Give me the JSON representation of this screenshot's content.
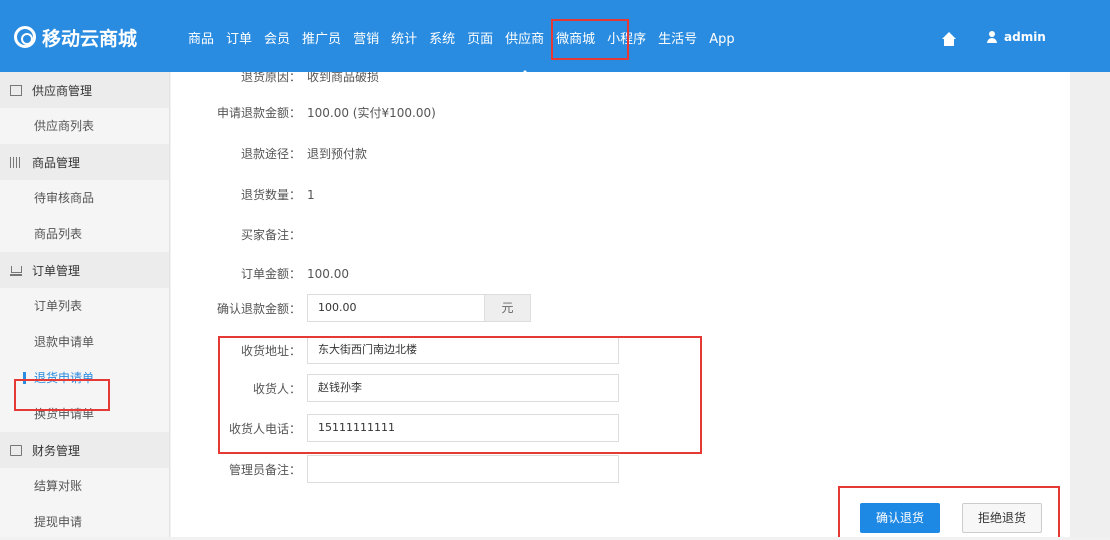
{
  "header": {
    "brand": "移动云商城",
    "nav": [
      "商品",
      "订单",
      "会员",
      "推广员",
      "营销",
      "统计",
      "系统",
      "页面",
      "供应商",
      "微商城",
      "小程序",
      "生活号",
      "App"
    ],
    "active_nav": "供应商",
    "user": "admin",
    "colors": {
      "bar": "#2a8ce0",
      "highlight": "#e53935"
    }
  },
  "sidebar": {
    "groups": [
      {
        "title": "供应商管理",
        "icon": "store-icon",
        "items": [
          "供应商列表"
        ]
      },
      {
        "title": "商品管理",
        "icon": "barcode-icon",
        "items": [
          "待审核商品",
          "商品列表"
        ]
      },
      {
        "title": "订单管理",
        "icon": "cart-icon",
        "items": [
          "订单列表",
          "退款申请单",
          "退货申请单",
          "换货申请单"
        ]
      },
      {
        "title": "财务管理",
        "icon": "money-icon",
        "items": [
          "结算对账",
          "提现申请"
        ]
      }
    ],
    "active_item": "退货申请单"
  },
  "form": {
    "cut_top_label": "退货原因：",
    "cut_top_value": "收到商品破损",
    "refund_amount_label": "申请退款金额：",
    "refund_amount_value": "100.00 (实付¥100.00)",
    "refund_route_label": "退款途径：",
    "refund_route_value": "退到预付款",
    "return_qty_label": "退货数量：",
    "return_qty_value": "1",
    "buyer_note_label": "买家备注：",
    "buyer_note_value": "",
    "order_amount_label": "订单金额：",
    "order_amount_value": "100.00",
    "confirm_amount_label": "确认退款金额：",
    "confirm_amount_value": "100.00",
    "unit": "元",
    "address_label": "收货地址：",
    "address_value": "东大街西门南边北楼",
    "receiver_label": "收货人：",
    "receiver_value": "赵钱孙李",
    "phone_label": "收货人电话：",
    "phone_value": "15111111111",
    "admin_note_label": "管理员备注：",
    "admin_note_value": ""
  },
  "actions": {
    "confirm": "确认退货",
    "reject": "拒绝退货"
  }
}
